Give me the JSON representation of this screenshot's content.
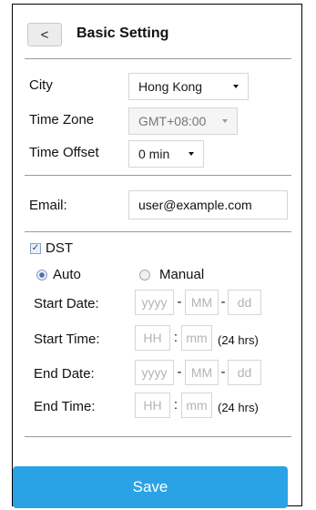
{
  "header": {
    "back_label": "<",
    "title": "Basic Setting"
  },
  "basic": {
    "city_label": "City",
    "city_value": "Hong Kong",
    "timezone_label": "Time Zone",
    "timezone_value": "GMT+08:00",
    "offset_label": "Time Offset",
    "offset_value": "0 min"
  },
  "email": {
    "label": "Email:",
    "value": "user@example.com"
  },
  "dst": {
    "checkbox_label": "DST",
    "checked": true,
    "mode_auto_label": "Auto",
    "mode_manual_label": "Manual",
    "selected_mode": "Auto",
    "start_date_label": "Start Date:",
    "start_time_label": "Start Time:",
    "end_date_label": "End Date:",
    "end_time_label": "End Time:",
    "date_sep": "-",
    "time_sep": ":",
    "placeholders": {
      "year": "yyyy",
      "month": "MM",
      "day": "dd",
      "hour": "HH",
      "minute": "mm"
    },
    "time_unit": "(24 hrs)"
  },
  "footer": {
    "save_label": "Save"
  },
  "colors": {
    "save_button": "#29a3e6",
    "divider": "#9a9a9a",
    "checkbox_mark": "#1d3e86"
  }
}
